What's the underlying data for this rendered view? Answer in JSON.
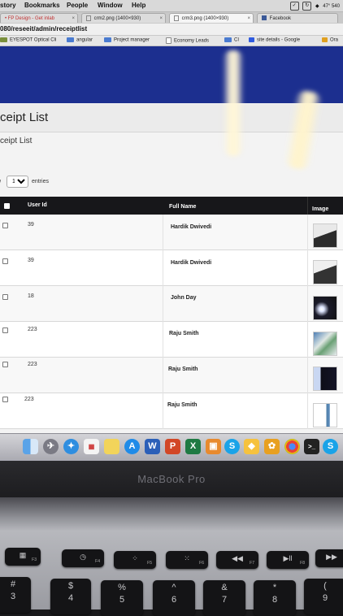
{
  "menubar": {
    "items": [
      "story",
      "Bookmarks",
      "People",
      "Window",
      "Help"
    ],
    "tray_text": "47°  540"
  },
  "browser_tabs": [
    {
      "label": "• FP Design - Get inlab",
      "active": false
    },
    {
      "label": "crm2.png (1400×930)",
      "active": false
    },
    {
      "label": "crm3.png (1400×930)",
      "active": true
    },
    {
      "label": "Facebook",
      "active": false
    }
  ],
  "url": "080/reseeit/admin/receiptlist",
  "bookmarks": [
    {
      "label": "EYESPOT Optical Cli",
      "icon_color": "#7a8f3c"
    },
    {
      "label": "angular",
      "icon_color": "#4a7bd0"
    },
    {
      "label": "Project manager",
      "icon_color": "#4a7bd0"
    },
    {
      "label": "Economy Leads",
      "icon_color": "#ffffff"
    },
    {
      "label": "CI",
      "icon_color": "#4a7bd0"
    },
    {
      "label": "site details - Google",
      "icon_color": "#2f5be0"
    },
    {
      "label": "Ora",
      "icon_color": "#e0a020"
    }
  ],
  "page": {
    "title": "ceipt List",
    "subtitle": "ceipt List"
  },
  "length_control": {
    "label": "w",
    "selected": "10",
    "after": "entries"
  },
  "table": {
    "columns": [
      "User Id",
      "Full Name",
      "Image"
    ],
    "rows": [
      {
        "user_id": "39",
        "full_name": "Hardik Dwivedi"
      },
      {
        "user_id": "39",
        "full_name": "Hardik Dwivedi"
      },
      {
        "user_id": "18",
        "full_name": "John Day"
      },
      {
        "user_id": "223",
        "full_name": "Raju Smith"
      },
      {
        "user_id": "223",
        "full_name": "Raju Smith"
      },
      {
        "user_id": "223",
        "full_name": "Raju Smith"
      }
    ]
  },
  "dock": {
    "icons": [
      "finder-icon",
      "launchpad-icon",
      "safari-icon",
      "calendar-icon",
      "notes-icon",
      "appstore-icon",
      "word-icon",
      "powerpoint-icon",
      "excel-icon",
      "photos-icon",
      "skype-icon",
      "sketch-icon",
      "chrome-icon",
      "terminal-icon",
      "skype-icon-2"
    ]
  },
  "laptop": {
    "brand": "MacBook Pro"
  },
  "keyboard": {
    "fn_keys": [
      {
        "glyph": "▦",
        "fn": "F3"
      },
      {
        "glyph": "◷",
        "fn": "F4"
      },
      {
        "glyph": "⁘",
        "fn": "F5"
      },
      {
        "glyph": "⁙",
        "fn": "F6"
      },
      {
        "glyph": "◀◀",
        "fn": "F7"
      },
      {
        "glyph": "▶ll",
        "fn": "F8"
      },
      {
        "glyph": "▶▶",
        "fn": ""
      }
    ],
    "number_keys": [
      {
        "top": "#",
        "bot": "3"
      },
      {
        "top": "$",
        "bot": "4"
      },
      {
        "top": "%",
        "bot": "5"
      },
      {
        "top": "^",
        "bot": "6"
      },
      {
        "top": "&",
        "bot": "7"
      },
      {
        "top": "*",
        "bot": "8"
      },
      {
        "top": "(",
        "bot": "9"
      }
    ]
  }
}
